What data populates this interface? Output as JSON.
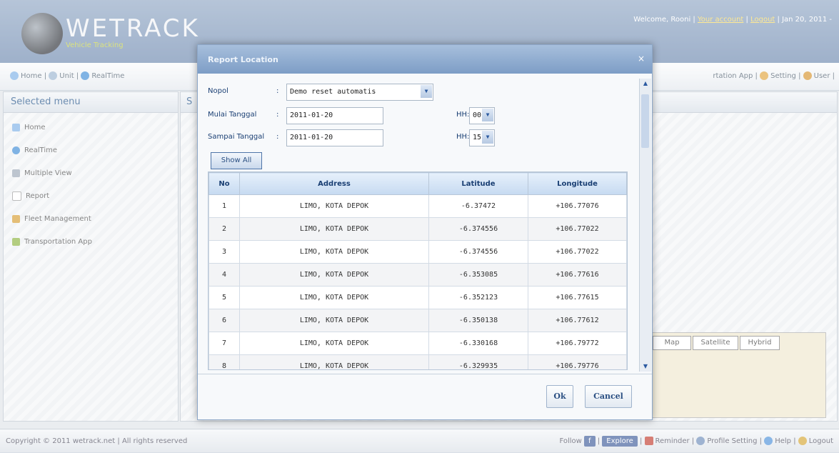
{
  "app": {
    "logo_text": "WETRACK",
    "logo_sub": "Vehicle Tracking"
  },
  "header": {
    "welcome": "Welcome, Rooni |",
    "link_account": "Your account",
    "link_logout": "Logout",
    "date": "| Jan 20, 2011 -"
  },
  "nav": {
    "left_items": [
      "Home",
      "Unit",
      "RealTime"
    ],
    "right_items": [
      "rtation App",
      "Setting",
      "User"
    ]
  },
  "sidebar": {
    "title": "Selected menu",
    "items": [
      {
        "label": "Home"
      },
      {
        "label": "RealTime"
      },
      {
        "label": "Multiple View"
      },
      {
        "label": "Report"
      },
      {
        "label": "Fleet Management"
      },
      {
        "label": "Transportation App"
      }
    ]
  },
  "main": {
    "title": "S",
    "map_types": [
      "Map",
      "Satellite",
      "Hybrid"
    ]
  },
  "dialog": {
    "title": "Report Location",
    "close": "×",
    "nopol_label": "Nopol",
    "nopol_colon": ":",
    "nopol_value": "Demo reset automatis",
    "mulai_label": "Mulai Tanggal",
    "mulai_colon": ":",
    "mulai_value": "2011-01-20",
    "mulai_hh_label": "HH:",
    "mulai_hh_value": "00",
    "sampai_label": "Sampai Tanggal",
    "sampai_colon": ":",
    "sampai_value": "2011-01-20",
    "sampai_hh_label": "HH:",
    "sampai_hh_value": "15",
    "show_all_label": "Show All",
    "ok_label": "Ok",
    "cancel_label": "Cancel"
  },
  "table": {
    "headers": [
      "No",
      "Address",
      "Latitude",
      "Longitude"
    ],
    "rows": [
      [
        "1",
        "LIMO, KOTA DEPOK",
        "-6.37472",
        "+106.77076"
      ],
      [
        "2",
        "LIMO, KOTA DEPOK",
        "-6.374556",
        "+106.77022"
      ],
      [
        "3",
        "LIMO, KOTA DEPOK",
        "-6.374556",
        "+106.77022"
      ],
      [
        "4",
        "LIMO, KOTA DEPOK",
        "-6.353085",
        "+106.77616"
      ],
      [
        "5",
        "LIMO, KOTA DEPOK",
        "-6.352123",
        "+106.77615"
      ],
      [
        "6",
        "LIMO, KOTA DEPOK",
        "-6.350138",
        "+106.77612"
      ],
      [
        "7",
        "LIMO, KOTA DEPOK",
        "-6.330168",
        "+106.79772"
      ],
      [
        "8",
        "LIMO, KOTA DEPOK",
        "-6.329935",
        "+106.79776"
      ]
    ]
  },
  "footer": {
    "copyright": "Copyright © 2011 wetrack.net | All rights reserved",
    "follow": "Follow",
    "explore": "Explore",
    "reminder": "Reminder",
    "profile_setting": "Profile Setting",
    "help": "Help",
    "logout": "Logout"
  }
}
